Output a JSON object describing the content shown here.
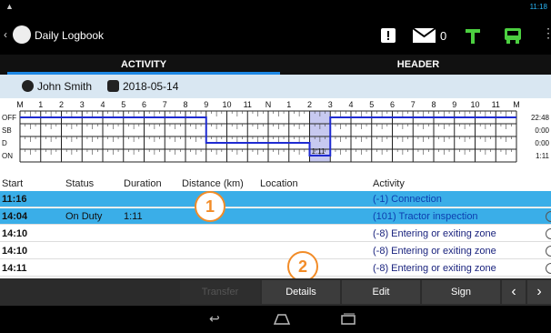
{
  "statusbar": {
    "time": "11:18"
  },
  "appbar": {
    "back_glyph": "‹",
    "title": "Daily Logbook",
    "message_count": "0"
  },
  "tabs": [
    {
      "label": "ACTIVITY"
    },
    {
      "label": "HEADER"
    }
  ],
  "driver": {
    "name": "John Smith",
    "date": "2018-05-14"
  },
  "graph": {
    "hour_labels": [
      "M",
      "1",
      "2",
      "3",
      "4",
      "5",
      "6",
      "7",
      "8",
      "9",
      "10",
      "11",
      "N",
      "1",
      "2",
      "3",
      "4",
      "5",
      "6",
      "7",
      "8",
      "9",
      "10",
      "11",
      "M"
    ],
    "rows": [
      {
        "label": "OFF",
        "total": "22:48"
      },
      {
        "label": "SB",
        "total": "0:00"
      },
      {
        "label": "D",
        "total": "0:00"
      },
      {
        "label": "ON",
        "total": "1:11"
      }
    ],
    "marker_label": "1:11"
  },
  "table": {
    "headers": [
      "Start",
      "Status",
      "Duration",
      "Distance (km)",
      "Location",
      "Activity"
    ],
    "rows": [
      {
        "start": "11:16",
        "status": "",
        "duration": "",
        "activity": "(-1) Connection"
      },
      {
        "start": "14:04",
        "status": "On Duty",
        "duration": "1:11",
        "activity": "(101) Tractor inspection"
      },
      {
        "start": "14:10",
        "status": "",
        "duration": "",
        "activity": "(-8) Entering or exiting zone"
      },
      {
        "start": "14:10",
        "status": "",
        "duration": "",
        "activity": "(-8) Entering or exiting zone"
      },
      {
        "start": "14:11",
        "status": "",
        "duration": "",
        "activity": "(-8) Entering or exiting zone"
      }
    ]
  },
  "callouts": [
    "1",
    "2"
  ],
  "toolbar": {
    "transfer": "Transfer",
    "details": "Details",
    "edit": "Edit",
    "sign": "Sign",
    "prev": "‹",
    "next": "›"
  },
  "colors": {
    "accent": "#1e88e5",
    "selected_row": "#3aaee8",
    "callout": "#f28c28",
    "graph_line": "#1f2bd1"
  }
}
